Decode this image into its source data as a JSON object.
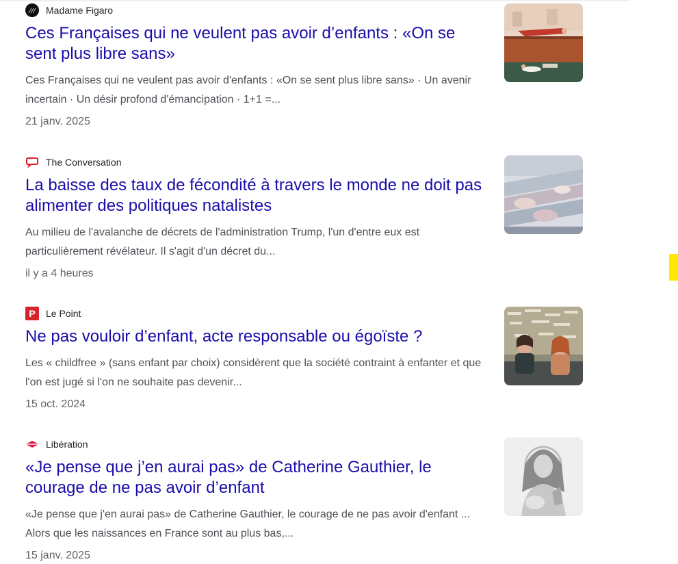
{
  "results": [
    {
      "source": "Madame Figaro",
      "source_icon": "madame-figaro-logo-icon",
      "title": "Ces Françaises qui ne veulent pas avoir d’enfants : «On se sent plus libre sans»",
      "snippet": "Ces Françaises qui ne veulent pas avoir d'enfants : «On se sent plus libre sans» · Un avenir incertain · Un désir profond d'émancipation · 1+1 =...",
      "date": "21 janv. 2025"
    },
    {
      "source": "The Conversation",
      "source_icon": "speech-bubble-icon",
      "title": "La baisse des taux de fécondité à travers le monde ne doit pas alimenter des politiques natalistes",
      "snippet": "Au milieu de l'avalanche de décrets de l'administration Trump, l'un d'entre eux est particulièrement révélateur. Il s'agit d'un décret du...",
      "date": "il y a 4 heures"
    },
    {
      "source": "Le Point",
      "source_icon": "le-point-logo-icon",
      "title": "Ne pas vouloir d’enfant, acte responsable ou égoïste ?",
      "snippet": "Les « childfree » (sans enfant par choix) considèrent que la société contraint à enfanter et que l'on est jugé si l'on ne souhaite pas devenir...",
      "date": "15 oct. 2024"
    },
    {
      "source": "Libération",
      "source_icon": "liberation-logo-icon",
      "title": "«Je pense que j’en aurai pas» de Catherine Gauthier, le courage de ne pas avoir d’enfant",
      "snippet": "«Je pense que j'en aurai pas» de Catherine Gauthier, le courage de ne pas avoir d'enfant ... Alors que les naissances en France sont au plus bas,...",
      "date": "15 janv. 2025"
    }
  ],
  "colors": {
    "title_link": "#1a0dab",
    "snippet": "#4d5156",
    "date": "#5f6368",
    "accent_yellow": "#ffe900"
  }
}
